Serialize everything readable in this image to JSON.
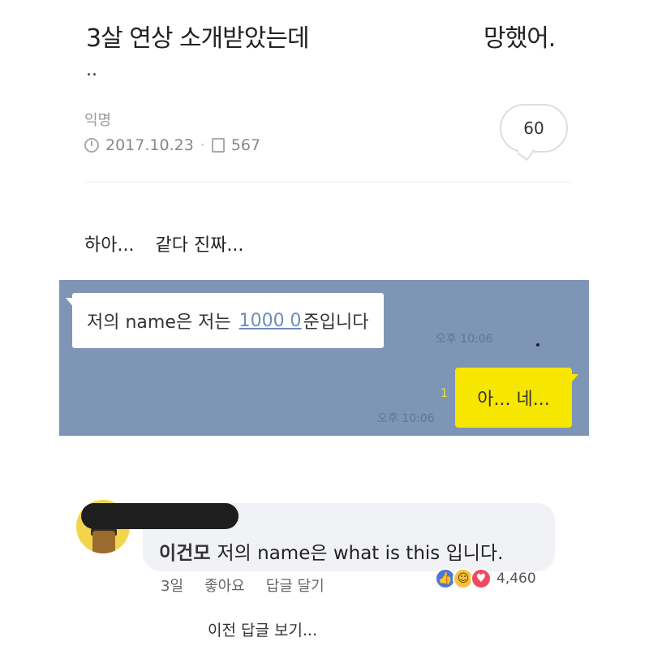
{
  "post": {
    "title_part1": "3살 연상 소개받았는데",
    "title_part2": "망했어.",
    "title_dots": "..",
    "author": "익명",
    "date": "2017.10.23",
    "separator": "·",
    "views": "567",
    "comment_count": "60"
  },
  "body": {
    "text_part1": "하아...",
    "text_part2": "같다 진짜..."
  },
  "chat": {
    "incoming_prefix": "저의 name은 저는",
    "incoming_link": "1000 0",
    "incoming_suffix": "준입니다",
    "incoming_time": "오후 10:06",
    "outgoing_text": "아... 네...",
    "outgoing_read": "1",
    "outgoing_time": "오후 10:06",
    "colors": {
      "background": "#7f95b6",
      "outgoing_bubble": "#f7e600"
    }
  },
  "comment": {
    "name": "이건모",
    "text": "저의 name은 what is this 입니다.",
    "age": "3일",
    "like_label": "좋아요",
    "reply_label": "답글 달기",
    "reaction_count": "4,460",
    "reactions": [
      "like-icon",
      "haha-icon",
      "love-icon"
    ]
  },
  "footer": {
    "prev_replies": "이전 답글 보기..."
  }
}
